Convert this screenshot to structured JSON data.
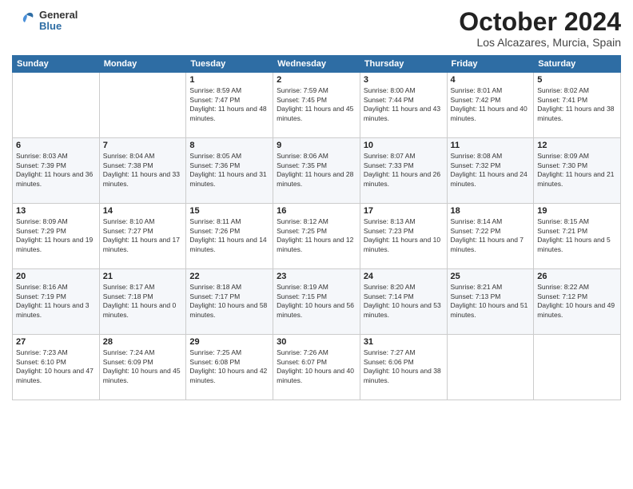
{
  "logo": {
    "general": "General",
    "blue": "Blue"
  },
  "title": "October 2024",
  "location": "Los Alcazares, Murcia, Spain",
  "days_of_week": [
    "Sunday",
    "Monday",
    "Tuesday",
    "Wednesday",
    "Thursday",
    "Friday",
    "Saturday"
  ],
  "weeks": [
    [
      null,
      null,
      {
        "day": 1,
        "sunrise": "8:59 AM",
        "sunset": "7:47 PM",
        "daylight": "11 hours and 48 minutes."
      },
      {
        "day": 2,
        "sunrise": "7:59 AM",
        "sunset": "7:45 PM",
        "daylight": "11 hours and 45 minutes."
      },
      {
        "day": 3,
        "sunrise": "8:00 AM",
        "sunset": "7:44 PM",
        "daylight": "11 hours and 43 minutes."
      },
      {
        "day": 4,
        "sunrise": "8:01 AM",
        "sunset": "7:42 PM",
        "daylight": "11 hours and 40 minutes."
      },
      {
        "day": 5,
        "sunrise": "8:02 AM",
        "sunset": "7:41 PM",
        "daylight": "11 hours and 38 minutes."
      }
    ],
    [
      {
        "day": 6,
        "sunrise": "8:03 AM",
        "sunset": "7:39 PM",
        "daylight": "11 hours and 36 minutes."
      },
      {
        "day": 7,
        "sunrise": "8:04 AM",
        "sunset": "7:38 PM",
        "daylight": "11 hours and 33 minutes."
      },
      {
        "day": 8,
        "sunrise": "8:05 AM",
        "sunset": "7:36 PM",
        "daylight": "11 hours and 31 minutes."
      },
      {
        "day": 9,
        "sunrise": "8:06 AM",
        "sunset": "7:35 PM",
        "daylight": "11 hours and 28 minutes."
      },
      {
        "day": 10,
        "sunrise": "8:07 AM",
        "sunset": "7:33 PM",
        "daylight": "11 hours and 26 minutes."
      },
      {
        "day": 11,
        "sunrise": "8:08 AM",
        "sunset": "7:32 PM",
        "daylight": "11 hours and 24 minutes."
      },
      {
        "day": 12,
        "sunrise": "8:09 AM",
        "sunset": "7:30 PM",
        "daylight": "11 hours and 21 minutes."
      }
    ],
    [
      {
        "day": 13,
        "sunrise": "8:09 AM",
        "sunset": "7:29 PM",
        "daylight": "11 hours and 19 minutes."
      },
      {
        "day": 14,
        "sunrise": "8:10 AM",
        "sunset": "7:27 PM",
        "daylight": "11 hours and 17 minutes."
      },
      {
        "day": 15,
        "sunrise": "8:11 AM",
        "sunset": "7:26 PM",
        "daylight": "11 hours and 14 minutes."
      },
      {
        "day": 16,
        "sunrise": "8:12 AM",
        "sunset": "7:25 PM",
        "daylight": "11 hours and 12 minutes."
      },
      {
        "day": 17,
        "sunrise": "8:13 AM",
        "sunset": "7:23 PM",
        "daylight": "11 hours and 10 minutes."
      },
      {
        "day": 18,
        "sunrise": "8:14 AM",
        "sunset": "7:22 PM",
        "daylight": "11 hours and 7 minutes."
      },
      {
        "day": 19,
        "sunrise": "8:15 AM",
        "sunset": "7:21 PM",
        "daylight": "11 hours and 5 minutes."
      }
    ],
    [
      {
        "day": 20,
        "sunrise": "8:16 AM",
        "sunset": "7:19 PM",
        "daylight": "11 hours and 3 minutes."
      },
      {
        "day": 21,
        "sunrise": "8:17 AM",
        "sunset": "7:18 PM",
        "daylight": "11 hours and 0 minutes."
      },
      {
        "day": 22,
        "sunrise": "8:18 AM",
        "sunset": "7:17 PM",
        "daylight": "10 hours and 58 minutes."
      },
      {
        "day": 23,
        "sunrise": "8:19 AM",
        "sunset": "7:15 PM",
        "daylight": "10 hours and 56 minutes."
      },
      {
        "day": 24,
        "sunrise": "8:20 AM",
        "sunset": "7:14 PM",
        "daylight": "10 hours and 53 minutes."
      },
      {
        "day": 25,
        "sunrise": "8:21 AM",
        "sunset": "7:13 PM",
        "daylight": "10 hours and 51 minutes."
      },
      {
        "day": 26,
        "sunrise": "8:22 AM",
        "sunset": "7:12 PM",
        "daylight": "10 hours and 49 minutes."
      }
    ],
    [
      {
        "day": 27,
        "sunrise": "7:23 AM",
        "sunset": "6:10 PM",
        "daylight": "10 hours and 47 minutes."
      },
      {
        "day": 28,
        "sunrise": "7:24 AM",
        "sunset": "6:09 PM",
        "daylight": "10 hours and 45 minutes."
      },
      {
        "day": 29,
        "sunrise": "7:25 AM",
        "sunset": "6:08 PM",
        "daylight": "10 hours and 42 minutes."
      },
      {
        "day": 30,
        "sunrise": "7:26 AM",
        "sunset": "6:07 PM",
        "daylight": "10 hours and 40 minutes."
      },
      {
        "day": 31,
        "sunrise": "7:27 AM",
        "sunset": "6:06 PM",
        "daylight": "10 hours and 38 minutes."
      },
      null,
      null
    ]
  ],
  "colors": {
    "header_bg": "#2e6da4",
    "alt_row": "#f5f7fa"
  }
}
